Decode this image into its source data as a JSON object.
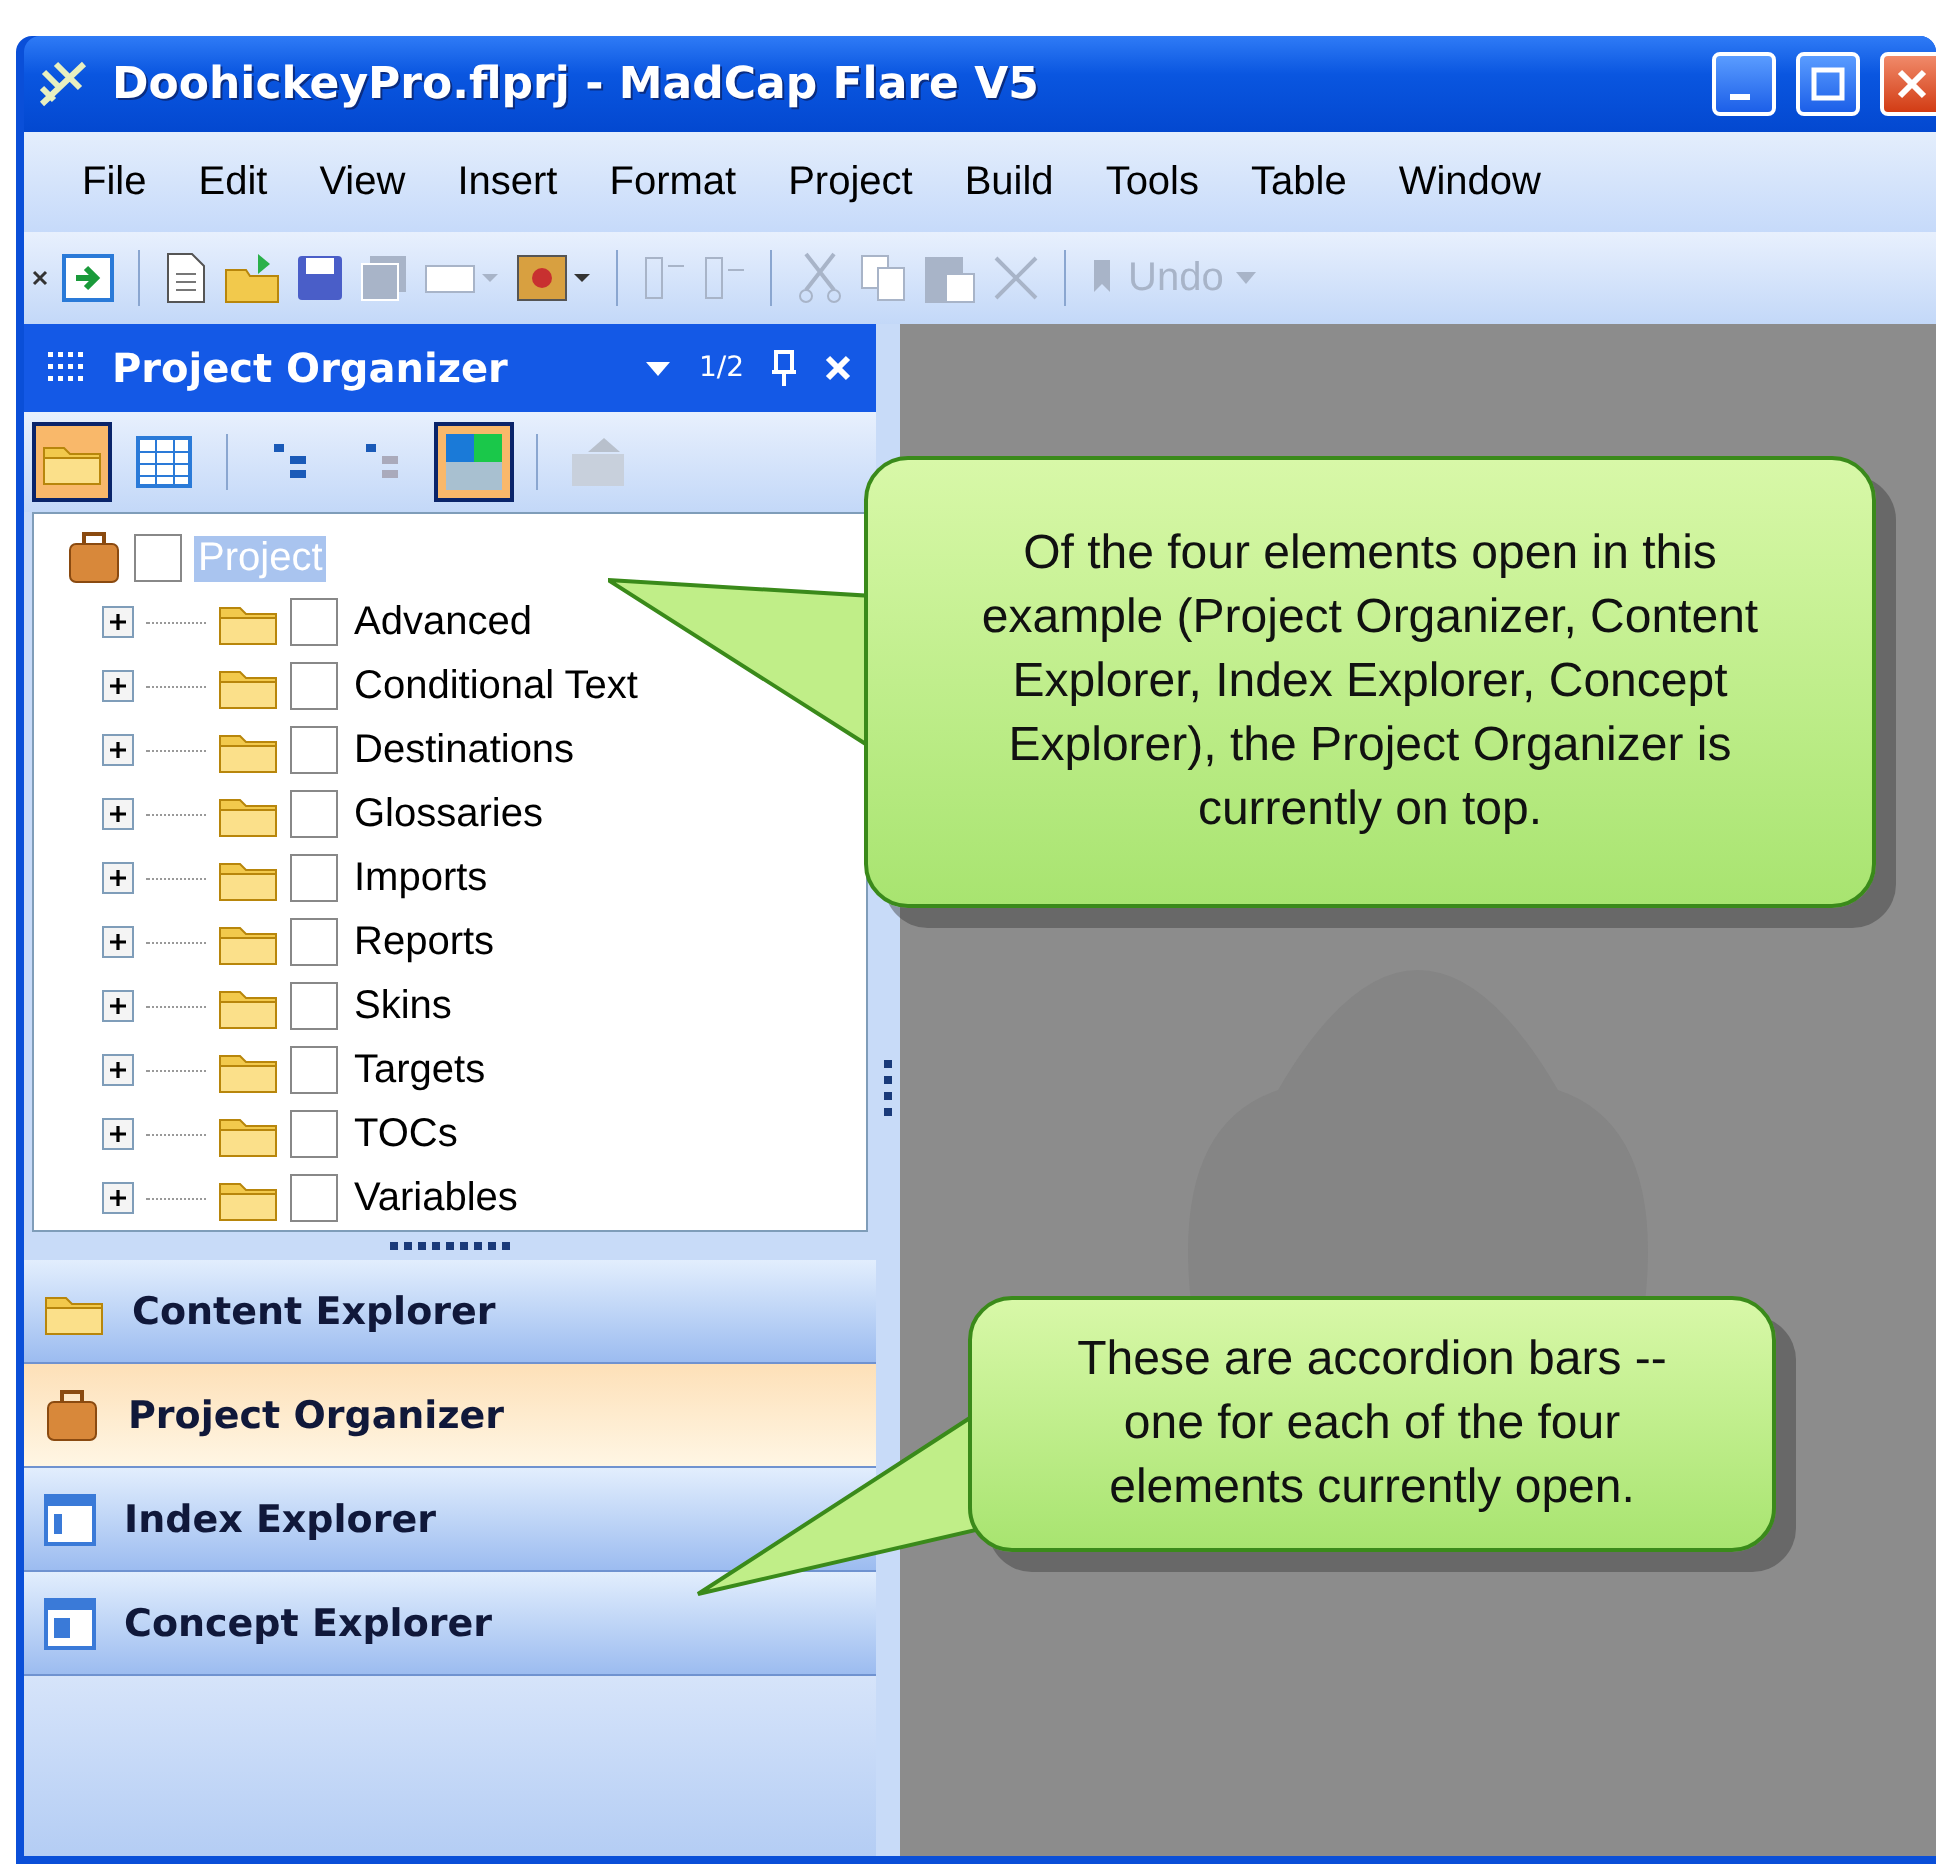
{
  "window": {
    "title": "DoohickeyPro.flprj - MadCap Flare V5"
  },
  "menu": [
    {
      "label": "File"
    },
    {
      "label": "Edit"
    },
    {
      "label": "View"
    },
    {
      "label": "Insert"
    },
    {
      "label": "Format"
    },
    {
      "label": "Project"
    },
    {
      "label": "Build"
    },
    {
      "label": "Tools"
    },
    {
      "label": "Table"
    },
    {
      "label": "Window"
    }
  ],
  "toolbar": [
    {
      "kind": "button",
      "disabled": false
    },
    {
      "kind": "separator"
    },
    {
      "kind": "button",
      "disabled": false
    },
    {
      "kind": "button",
      "disabled": false
    },
    {
      "kind": "button",
      "disabled": false
    },
    {
      "kind": "button",
      "disabled": true
    },
    {
      "kind": "dropdown",
      "disabled": true
    },
    {
      "kind": "dropdown",
      "disabled": false
    },
    {
      "kind": "separator"
    },
    {
      "kind": "button",
      "disabled": true
    },
    {
      "kind": "button",
      "disabled": true
    },
    {
      "kind": "separator"
    },
    {
      "kind": "button",
      "disabled": true
    },
    {
      "kind": "button",
      "disabled": true
    },
    {
      "kind": "button",
      "disabled": true
    },
    {
      "kind": "button",
      "disabled": true
    },
    {
      "kind": "separator"
    },
    {
      "kind": "text",
      "label": "Undo",
      "disabled": true
    }
  ],
  "panel": {
    "title": "Project Organizer",
    "page": "1/2",
    "tools": [
      {
        "kind": "button",
        "pressed": true
      },
      {
        "kind": "button",
        "pressed": false
      },
      {
        "kind": "separator"
      },
      {
        "kind": "button",
        "pressed": false
      },
      {
        "kind": "button",
        "pressed": false
      },
      {
        "kind": "button",
        "pressed": true
      },
      {
        "kind": "separator"
      },
      {
        "kind": "button",
        "pressed": false,
        "disabled": true
      }
    ],
    "tree": {
      "label": "Project",
      "selected": true,
      "checked": false,
      "children": [
        {
          "label": "Advanced",
          "checked": false,
          "expanded": false
        },
        {
          "label": "Conditional Text",
          "checked": false,
          "expanded": false
        },
        {
          "label": "Destinations",
          "checked": false,
          "expanded": false
        },
        {
          "label": "Glossaries",
          "checked": false,
          "expanded": false
        },
        {
          "label": "Imports",
          "checked": false,
          "expanded": false
        },
        {
          "label": "Reports",
          "checked": false,
          "expanded": false
        },
        {
          "label": "Skins",
          "checked": false,
          "expanded": false
        },
        {
          "label": "Targets",
          "checked": false,
          "expanded": false
        },
        {
          "label": "TOCs",
          "checked": false,
          "expanded": false
        },
        {
          "label": "Variables",
          "checked": false,
          "expanded": false
        }
      ]
    }
  },
  "accordion": [
    {
      "label": "Content Explorer",
      "selected": false
    },
    {
      "label": "Project Organizer",
      "selected": true
    },
    {
      "label": "Index Explorer",
      "selected": false
    },
    {
      "label": "Concept Explorer",
      "selected": false
    }
  ],
  "callouts": [
    {
      "text": "Of the four elements open in this example (Project Organizer, Content Explorer, Index Explorer, Concept Explorer), the Project Organizer is currently on top."
    },
    {
      "text": "These are accordion bars -- one for each of the four elements currently open."
    }
  ]
}
